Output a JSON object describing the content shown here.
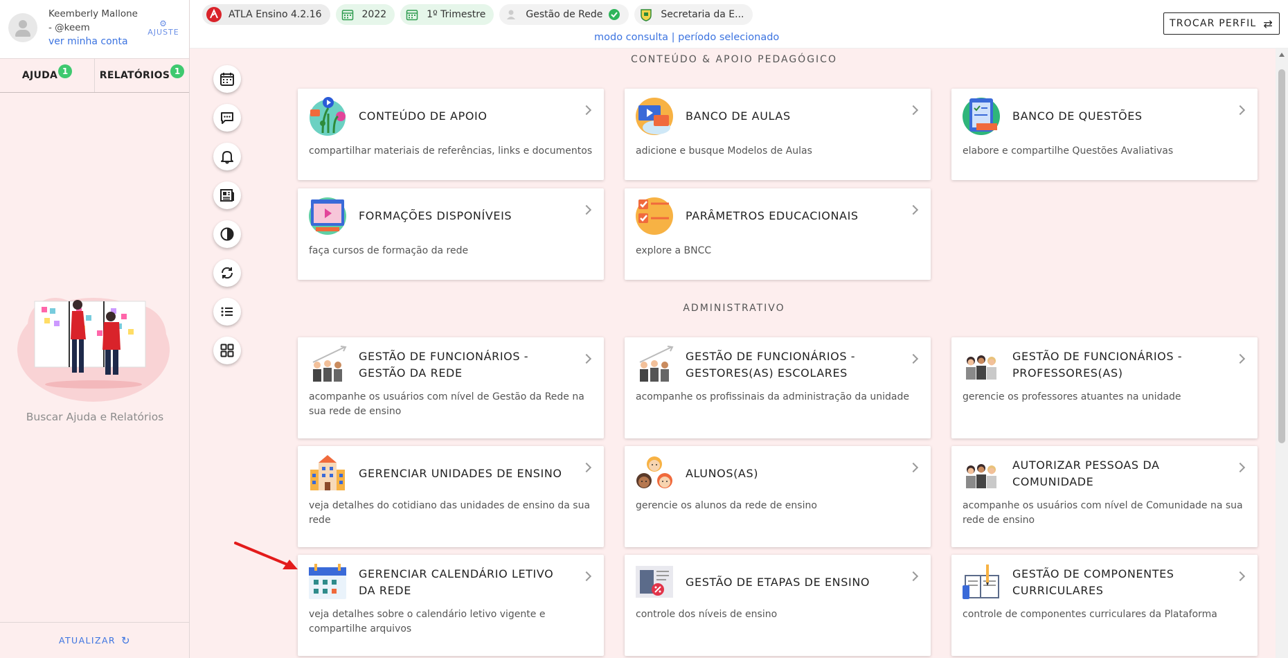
{
  "user": {
    "name": "Keemberly Mallone",
    "handle": "- @keem",
    "account_link": "ver minha conta",
    "settings_label": "AJUSTE"
  },
  "sidebar": {
    "tabs": [
      {
        "label": "AJUDA",
        "badge": "1"
      },
      {
        "label": "RELATÓRIOS",
        "badge": "1"
      }
    ],
    "help_text": "Buscar Ajuda e Relatórios",
    "refresh_label": "ATUALIZAR"
  },
  "topbar": {
    "chips": [
      {
        "label": "ATLA Ensino 4.2.16",
        "icon": "atla-logo-icon"
      },
      {
        "label": "2022",
        "icon": "calendar-icon"
      },
      {
        "label": "1º Trimestre",
        "icon": "calendar-icon"
      },
      {
        "label": "Gestão de Rede",
        "icon": "user-icon"
      },
      {
        "label": "Secretaria da E...",
        "icon": "crest-icon"
      }
    ],
    "mode_line": "modo consulta | período selecionado",
    "switch_profile": "TROCAR PERFIL"
  },
  "rail": [
    "calendar-icon",
    "chat-icon",
    "bell-icon",
    "news-icon",
    "contrast-icon",
    "sync-icon",
    "list-icon",
    "grid-icon"
  ],
  "sections": {
    "pedagogico": "CONTEÚDO & APOIO PEDAGÓGICO",
    "administrativo": "ADMINISTRATIVO"
  },
  "cards": {
    "conteudo_apoio": {
      "title": "CONTEÚDO DE APOIO",
      "desc": "compartilhar materiais de referências, links e documentos"
    },
    "banco_aulas": {
      "title": "BANCO DE AULAS",
      "desc": "adicione e busque Modelos de Aulas"
    },
    "banco_questoes": {
      "title": "BANCO DE QUESTÕES",
      "desc": "elabore e compartilhe Questões Avaliativas"
    },
    "formacoes": {
      "title": "FORMAÇÕES DISPONÍVEIS",
      "desc": "faça cursos de formação da rede"
    },
    "parametros": {
      "title": "PARÂMETROS EDUCACIONAIS",
      "desc": "explore a BNCC"
    },
    "func_gestao": {
      "title": "GESTÃO DE FUNCIONÁRIOS - GESTÃO DA REDE",
      "desc": "acompanhe os usuários com nível de Gestão da Rede na sua rede de ensino"
    },
    "func_gestores": {
      "title": "GESTÃO DE FUNCIONÁRIOS - GESTORES(AS) ESCOLARES",
      "desc": "acompanhe os profissinais da administração da unidade"
    },
    "func_professores": {
      "title": "GESTÃO DE FUNCIONÁRIOS - PROFESSORES(AS)",
      "desc": "gerencie os professores atuantes na unidade"
    },
    "unidades": {
      "title": "GERENCIAR UNIDADES DE ENSINO",
      "desc": "veja detalhes do cotidiano das unidades de ensino da sua rede"
    },
    "alunos": {
      "title": "ALUNOS(AS)",
      "desc": "gerencie os alunos da rede de ensino"
    },
    "comunidade": {
      "title": "AUTORIZAR PESSOAS DA COMUNIDADE",
      "desc": "acompanhe os usuários com nível de Comunidade na sua rede de ensino"
    },
    "calendario": {
      "title": "GERENCIAR CALENDÁRIO LETIVO DA REDE",
      "desc": "veja detalhes sobre o calendário letivo vigente e compartilhe arquivos"
    },
    "etapas": {
      "title": "GESTÃO DE ETAPAS DE ENSINO",
      "desc": "controle dos níveis de ensino"
    },
    "componentes": {
      "title": "GESTÃO DE COMPONENTES CURRICULARES",
      "desc": "controle de componentes curriculares da Plataforma"
    }
  },
  "colors": {
    "accent": "#3b73e0",
    "background": "#fdeeee",
    "badge": "#3ec96f",
    "annotation_arrow": "#e31b1b"
  }
}
